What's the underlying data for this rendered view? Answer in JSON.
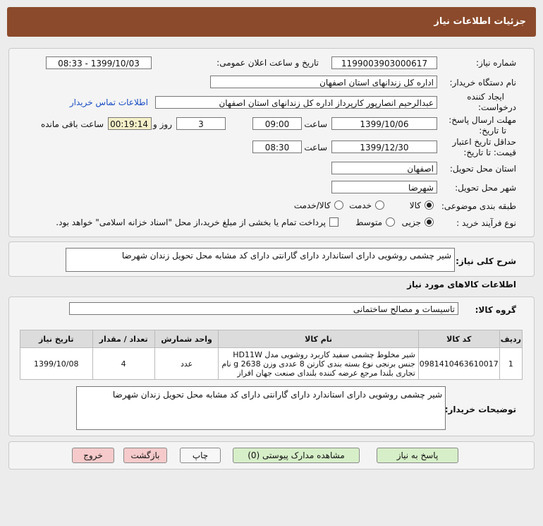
{
  "header": {
    "title": "جزئیات اطلاعات نیاز"
  },
  "form": {
    "need_number_label": "شماره نیاز:",
    "need_number": "1199003903000617",
    "announce_label": "تاریخ و ساعت اعلان عمومی:",
    "announce_value": "1399/10/03 - 08:33",
    "buyer_org_label": "نام دستگاه خریدار:",
    "buyer_org": "اداره کل زندانهای استان اصفهان",
    "creator_label_1": "ایجاد کننده",
    "creator_label_2": "درخواست:",
    "creator": "عبدالرحیم انصارپور کارپرداز اداره کل زندانهای استان اصفهان",
    "contact_link": "اطلاعات تماس خریدار",
    "deadline_label_1": "مهلت ارسال پاسخ:",
    "deadline_label_2": "تا تاریخ:",
    "deadline_date": "1399/10/06",
    "time_label": "ساعت",
    "deadline_time": "09:00",
    "days_value": "3",
    "days_label": "روز و",
    "remaining_time": "00:19:14",
    "remaining_label": "ساعت باقی مانده",
    "validity_label_1": "حداقل تاریخ اعتبار",
    "validity_label_2": "قیمت: تا تاریخ:",
    "validity_date": "1399/12/30",
    "validity_time": "08:30",
    "province_label": "استان محل تحویل:",
    "province": "اصفهان",
    "city_label": "شهر محل تحویل:",
    "city": "شهرضا",
    "category_label": "طبقه بندی موضوعی:",
    "category_options": [
      "کالا",
      "خدمت",
      "کالا/خدمت"
    ],
    "process_label": "نوع فرآیند خرید :",
    "process_options": [
      "جزیی",
      "متوسط"
    ],
    "payment_note": "پرداخت تمام یا بخشی از مبلغ خرید،از محل \"اسناد خزانه اسلامی\" خواهد بود."
  },
  "description": {
    "label": "شرح کلی نیاز:",
    "text": "شیر چشمی روشویی دارای استاندارد دارای گارانتی دارای کد مشابه محل تحویل زندان شهرضا"
  },
  "items_section": {
    "title": "اطلاعات کالاهای مورد نیاز",
    "group_label": "گروه کالا:",
    "group_value": "تاسیسات و مصالح ساختمانی",
    "columns": [
      "ردیف",
      "کد کالا",
      "نام کالا",
      "واحد شمارش",
      "تعداد / مقدار",
      "تاریخ نیاز"
    ],
    "rows": [
      {
        "row": "1",
        "code": "0981410463610017",
        "name_lines": [
          "شیر مخلوط چشمی سفید کاربرد روشویی مدل HD11W",
          "جنس برنجی نوع بسته بندی کارتن 8 عددی وزن 2638 g نام",
          "تجاری بلندا مرجع عرضه کننده بلندای صنعت جهان افراز"
        ],
        "unit": "عدد",
        "qty": "4",
        "date": "1399/10/08"
      }
    ]
  },
  "buyer_notes": {
    "label": "توضیحات خریدار:",
    "text": "شیر چشمی روشویی دارای استاندارد دارای گارانتی دارای کد مشابه محل تحویل زندان شهرضا"
  },
  "buttons": {
    "reply": "پاسخ به نیاز",
    "attachments": "مشاهده مدارک پیوستی (0)",
    "print": "چاپ",
    "back": "بازگشت",
    "exit": "خروج"
  },
  "colors": {
    "header_bg": "#8b4a2b",
    "link": "#1a4fc4",
    "timer_bg": "#f5f0c8"
  }
}
